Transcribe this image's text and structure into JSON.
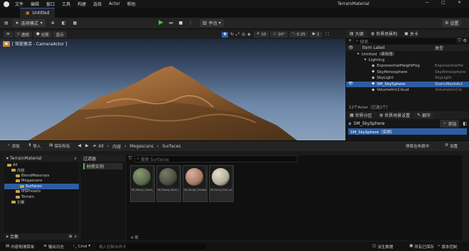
{
  "window": {
    "menu": [
      "文件",
      "编辑",
      "窗口",
      "工具",
      "构建",
      "选择",
      "Actor",
      "帮助"
    ],
    "project_name": "TerrainMaterial"
  },
  "doc_tab": "Untitled",
  "toolbar": {
    "mode": "选项模式",
    "platform": "平台",
    "settings": "设置"
  },
  "viewport": {
    "perspective": "透视",
    "lit": "光照",
    "show": "显示",
    "camera_label": "[ 驾驶激活 - CameraActor ]",
    "snap_values": [
      "10",
      "10°",
      "0.25",
      "1"
    ]
  },
  "outliner": {
    "tab_outliner": "大纲",
    "tab_world_settings": "世界场景构",
    "tab_close": "关卡",
    "search_placeholder": "搜索...",
    "col_label": "Item Label",
    "col_type": "类型",
    "rows": [
      {
        "label": "Untitled（编辑器）",
        "type": "",
        "indent": 0
      },
      {
        "label": "Lighting",
        "type": "",
        "indent": 1
      },
      {
        "label": "ExponentialHeightFog",
        "type": "ExponentialHe",
        "indent": 2
      },
      {
        "label": "SkyAtmosphere",
        "type": "SkyAtmosphere",
        "indent": 2
      },
      {
        "label": "SkyLight",
        "type": "SkyLight",
        "indent": 2
      },
      {
        "label": "SM_SkySphere",
        "type": "StaticMeshAct",
        "indent": 2,
        "selected": true
      },
      {
        "label": "VolumetricCloud",
        "type": "VolumetricClo",
        "indent": 2
      }
    ],
    "actor_count": "12个Actor（已选1个）"
  },
  "details": {
    "tab_world_partition": "世界分区",
    "tab_world_settings": "世界场景设置",
    "tab_details": "细节",
    "object_name": "SM_SkySphere",
    "add_button": "添加",
    "instance_row": "SM_SkySphere（实例）"
  },
  "content_browser": {
    "add": "添加",
    "import": "导入",
    "save_all": "保存所有",
    "breadcrumb": [
      "All",
      "内容",
      "Megascans",
      "Surfaces"
    ],
    "dock_label": "停靠在布局中",
    "settings": "设置",
    "project_header": "TerrainMaterial",
    "tree": [
      {
        "label": "All",
        "indent": 0
      },
      {
        "label": "内容",
        "indent": 1
      },
      {
        "label": "BlendMaterials",
        "indent": 2
      },
      {
        "label": "Megascans",
        "indent": 2
      },
      {
        "label": "Surfaces",
        "indent": 3,
        "selected": true
      },
      {
        "label": "MSPresets",
        "indent": 2
      },
      {
        "label": "Terrain",
        "indent": 2
      },
      {
        "label": "引擎",
        "indent": 1
      }
    ],
    "collections": "合集",
    "filters_title": "过滤器",
    "filter_chip": "材质实例",
    "search_placeholder": "搜索 Surfaces",
    "assets": [
      {
        "name": "MI_Mossy_Grass_ubmklx_2K",
        "color": "#5a6a4a",
        "hl": "#8a9a70"
      },
      {
        "name": "MI_Mossy_Rock_ubmcsg_2K",
        "color": "#4c4e40",
        "hl": "#7a7c66"
      },
      {
        "name": "MI_Rough_Sandstone_Rock_ubyle",
        "color": "#a77a66",
        "hl": "#d6b1a0"
      },
      {
        "name": "MI_Sand_Fine_ucbqeat_2K",
        "color": "#b3ab96",
        "hl": "#e6e0cf"
      }
    ],
    "item_count": "4 项"
  },
  "statusbar": {
    "content_drawer": "内容侧滑菜单",
    "output_log": "输出日志",
    "cmd": "Cmd",
    "console_placeholder": "输入控制台命令",
    "derived_data": "派生数据",
    "all_saved": "所有已保存",
    "source_control": "版本控制"
  }
}
